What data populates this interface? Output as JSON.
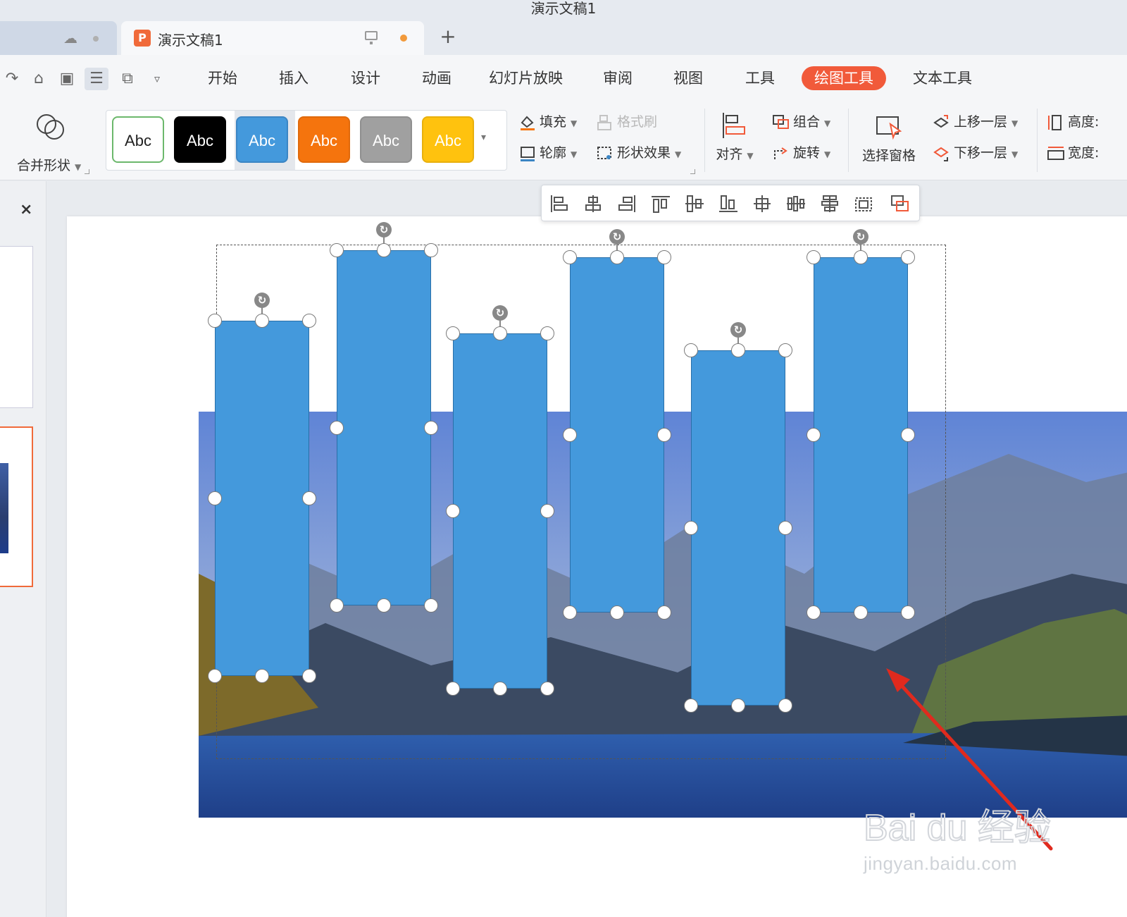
{
  "window": {
    "title": "演示文稿1"
  },
  "tabs": {
    "active_label": "演示文稿1",
    "ppt_icon_letter": "P",
    "add_label": "+"
  },
  "menu": {
    "items": [
      "开始",
      "插入",
      "设计",
      "动画",
      "幻灯片放映",
      "审阅",
      "视图",
      "工具",
      "绘图工具",
      "文本工具"
    ],
    "highlighted": "绘图工具",
    "accent_color": "#f15a3a"
  },
  "ribbon": {
    "merge_shapes": "合并形状",
    "style_label": "Abc",
    "style_swatches": [
      {
        "bg": "#ffffff",
        "fg": "#222222",
        "border": "#6cb86c"
      },
      {
        "bg": "#000000",
        "fg": "#ffffff",
        "border": "#000000"
      },
      {
        "bg": "#4499dc",
        "fg": "#ffffff",
        "border": "#3b85c4"
      },
      {
        "bg": "#f5740d",
        "fg": "#ffffff",
        "border": "#e06a0c"
      },
      {
        "bg": "#a0a0a0",
        "fg": "#ffffff",
        "border": "#909090"
      },
      {
        "bg": "#ffc20e",
        "fg": "#ffffff",
        "border": "#e8b00d"
      }
    ],
    "fill": "填充",
    "format_painter": "格式刷",
    "outline": "轮廓",
    "shape_effects": "形状效果",
    "align": "对齐",
    "group": "组合",
    "rotate": "旋转",
    "selection_pane": "选择窗格",
    "bring_forward": "上移一层",
    "send_backward": "下移一层",
    "height": "高度:",
    "width": "宽度:"
  },
  "panel": {
    "close_label": "×"
  },
  "shapes": {
    "count": 6,
    "fill_color": "#4499dc"
  },
  "watermark": {
    "text": "jingyan.baidu.com",
    "brand": "Bai du 经验"
  }
}
